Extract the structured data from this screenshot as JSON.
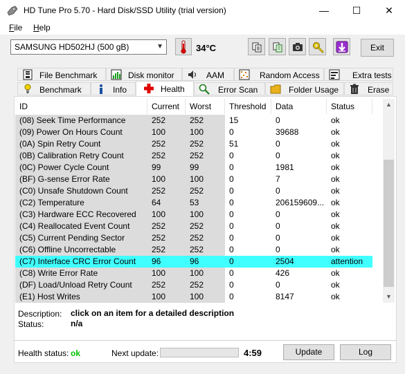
{
  "window": {
    "title": "HD Tune Pro 5.70 - Hard Disk/SSD Utility (trial version)",
    "minimize": "—",
    "maximize": "☐",
    "close": "✕"
  },
  "menu": [
    {
      "label": "File",
      "underline": "F",
      "rest": "ile"
    },
    {
      "label": "Help",
      "underline": "H",
      "rest": "elp"
    }
  ],
  "toolbar": {
    "drive": "SAMSUNG HD502HJ (500 gB)",
    "temperature": "34°C",
    "icons": [
      "copy-icon",
      "save-icon",
      "camera-icon",
      "wrench-icon",
      "download-icon"
    ],
    "exit_label": "Exit"
  },
  "tabs": {
    "row1": [
      {
        "label": "File Benchmark",
        "icon": "file-benchmark-icon"
      },
      {
        "label": "Disk monitor",
        "icon": "disk-monitor-icon"
      },
      {
        "label": "AAM",
        "icon": "speaker-icon"
      },
      {
        "label": "Random Access",
        "icon": "random-access-icon"
      },
      {
        "label": "Extra tests",
        "icon": "extra-tests-icon"
      }
    ],
    "row2": [
      {
        "label": "Benchmark",
        "icon": "benchmark-icon"
      },
      {
        "label": "Info",
        "icon": "info-icon"
      },
      {
        "label": "Health",
        "icon": "health-cross-icon",
        "active": true
      },
      {
        "label": "Error Scan",
        "icon": "error-scan-icon"
      },
      {
        "label": "Folder Usage",
        "icon": "folder-icon"
      },
      {
        "label": "Erase",
        "icon": "trash-icon"
      }
    ]
  },
  "table": {
    "columns": [
      "ID",
      "Current",
      "Worst",
      "Threshold",
      "Data",
      "Status"
    ],
    "rows": [
      [
        "(08) Seek Time Performance",
        "252",
        "252",
        "15",
        "0",
        "ok"
      ],
      [
        "(09) Power On Hours Count",
        "100",
        "100",
        "0",
        "39688",
        "ok"
      ],
      [
        "(0A) Spin Retry Count",
        "252",
        "252",
        "51",
        "0",
        "ok"
      ],
      [
        "(0B) Calibration Retry Count",
        "252",
        "252",
        "0",
        "0",
        "ok"
      ],
      [
        "(0C) Power Cycle Count",
        "99",
        "99",
        "0",
        "1981",
        "ok"
      ],
      [
        "(BF) G-sense Error Rate",
        "100",
        "100",
        "0",
        "7",
        "ok"
      ],
      [
        "(C0) Unsafe Shutdown Count",
        "252",
        "252",
        "0",
        "0",
        "ok"
      ],
      [
        "(C2) Temperature",
        "64",
        "53",
        "0",
        "206159609...",
        "ok"
      ],
      [
        "(C3) Hardware ECC Recovered",
        "100",
        "100",
        "0",
        "0",
        "ok"
      ],
      [
        "(C4) Reallocated Event Count",
        "252",
        "252",
        "0",
        "0",
        "ok"
      ],
      [
        "(C5) Current Pending Sector",
        "252",
        "252",
        "0",
        "0",
        "ok"
      ],
      [
        "(C6) Offline Uncorrectable",
        "252",
        "252",
        "0",
        "0",
        "ok"
      ],
      [
        "(C7) Interface CRC Error Count",
        "96",
        "96",
        "0",
        "2504",
        "attention"
      ],
      [
        "(C8) Write Error Rate",
        "100",
        "100",
        "0",
        "426",
        "ok"
      ],
      [
        "(DF) Load/Unload Retry Count",
        "252",
        "252",
        "0",
        "0",
        "ok"
      ],
      [
        "(E1) Host Writes",
        "100",
        "100",
        "0",
        "8147",
        "ok"
      ]
    ],
    "highlighted_row": 12,
    "highlight_color": "#40ffff"
  },
  "description": {
    "label": "Description:",
    "value": "click on an item for a detailed description",
    "status_label": "Status:",
    "status_value": "n/a"
  },
  "footer": {
    "health_label": "Health status:",
    "health_value": "ok",
    "next_label": "Next update:",
    "progress_fraction": 0.0,
    "time": "4:59",
    "update_label": "Update",
    "log_label": "Log"
  }
}
